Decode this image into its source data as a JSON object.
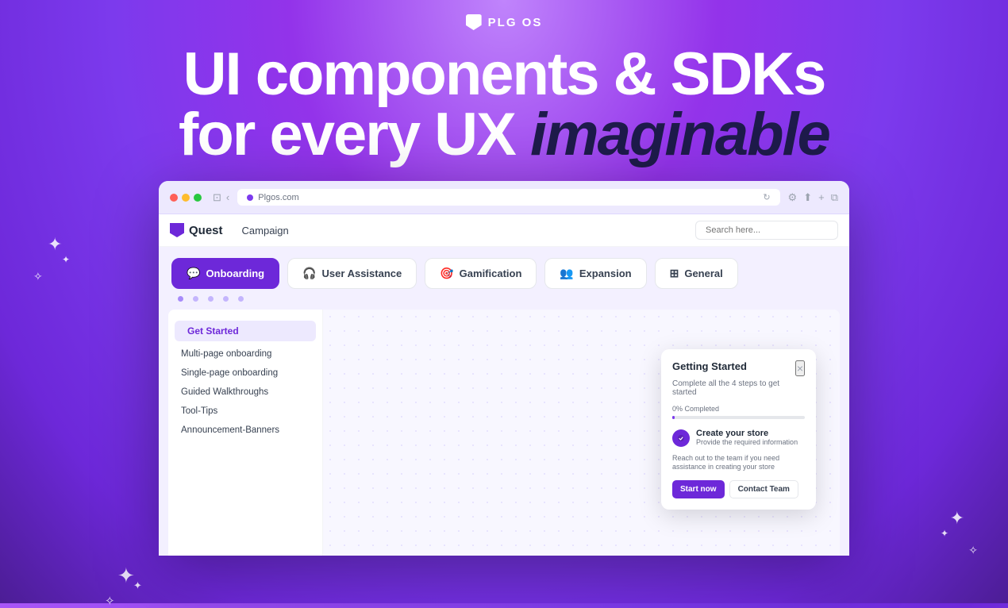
{
  "brand": {
    "logo_text": "PLG OS",
    "logo_symbol": "▼"
  },
  "hero": {
    "line1": "UI components & SDKs",
    "line2_start": "for every UX ",
    "line2_italic": "imaginable"
  },
  "browser": {
    "url": "Plgos.com",
    "traffic_lights": [
      "red",
      "yellow",
      "green"
    ]
  },
  "tabs": [
    {
      "id": "onboarding",
      "label": "Onboarding",
      "icon": "💬",
      "active": true
    },
    {
      "id": "user-assistance",
      "label": "User Assistance",
      "icon": "🎧",
      "active": false
    },
    {
      "id": "gamification",
      "label": "Gamification",
      "icon": "🎯",
      "active": false
    },
    {
      "id": "expansion",
      "label": "Expansion",
      "icon": "👥",
      "active": false
    },
    {
      "id": "general",
      "label": "General",
      "icon": "⊞",
      "active": false
    }
  ],
  "inner_app": {
    "logo_text": "Quest",
    "campaign_label": "Campaign",
    "search_placeholder": "Search here..."
  },
  "sidebar": {
    "section_header": "Get Started",
    "items": [
      "Multi-page onboarding",
      "Single-page onboarding",
      "Guided Walkthroughs",
      "Tool-Tips",
      "Announcement-Banners"
    ]
  },
  "getting_started_card": {
    "title": "Getting Started",
    "subtitle": "Complete all the 4 steps to get started",
    "progress_label": "0% Completed",
    "progress_value": 0,
    "task_title": "Create your store",
    "task_desc": "Provide the required information",
    "task_help": "Reach out to the team if you need assistance in creating your store",
    "btn_start": "Start now",
    "btn_contact": "Contact Team",
    "close_icon": "×"
  },
  "sparkles": {
    "symbols": [
      "✦",
      "✧",
      "✦",
      "✦",
      "✧",
      "✦",
      "✦",
      "✧",
      "✦"
    ]
  }
}
